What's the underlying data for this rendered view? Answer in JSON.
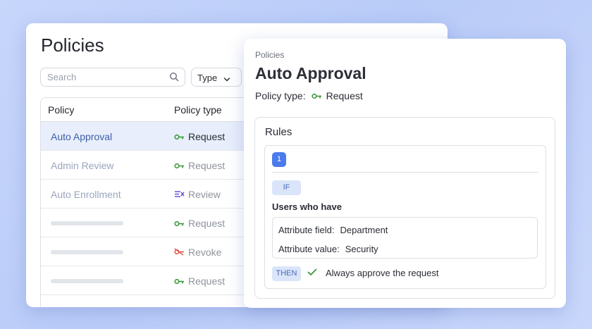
{
  "list": {
    "title": "Policies",
    "search_placeholder": "Search",
    "type_filter_label": "Type",
    "columns": [
      "Policy",
      "Policy type"
    ],
    "rows": [
      {
        "name": "Auto Approval",
        "type": "Request",
        "type_icon": "key-icon",
        "active": true
      },
      {
        "name": "Admin Review",
        "type": "Request",
        "type_icon": "key-icon",
        "active": false
      },
      {
        "name": "Auto Enrollment",
        "type": "Review",
        "type_icon": "review-icon",
        "active": false
      },
      {
        "name": "",
        "type": "Request",
        "type_icon": "key-icon",
        "active": false
      },
      {
        "name": "",
        "type": "Revoke",
        "type_icon": "revoke-icon",
        "active": false
      },
      {
        "name": "",
        "type": "Request",
        "type_icon": "key-icon",
        "active": false
      }
    ]
  },
  "detail": {
    "breadcrumb": "Policies",
    "title": "Auto Approval",
    "policy_type_label": "Policy type:",
    "policy_type_value": "Request",
    "rules_title": "Rules",
    "rule": {
      "number": "1",
      "if_label": "IF",
      "condition_title": "Users who have",
      "attribute_field_label": "Attribute field:",
      "attribute_field_value": "Department",
      "attribute_value_label": "Attribute value:",
      "attribute_value_value": "Security",
      "then_label": "THEN",
      "action": "Always approve the request"
    }
  },
  "colors": {
    "accent": "#4b7bec",
    "key_icon": "#3a9a3a",
    "review_icon": "#6a4fd8",
    "revoke_icon": "#e05a4f",
    "active_row": "#e8eefb"
  }
}
